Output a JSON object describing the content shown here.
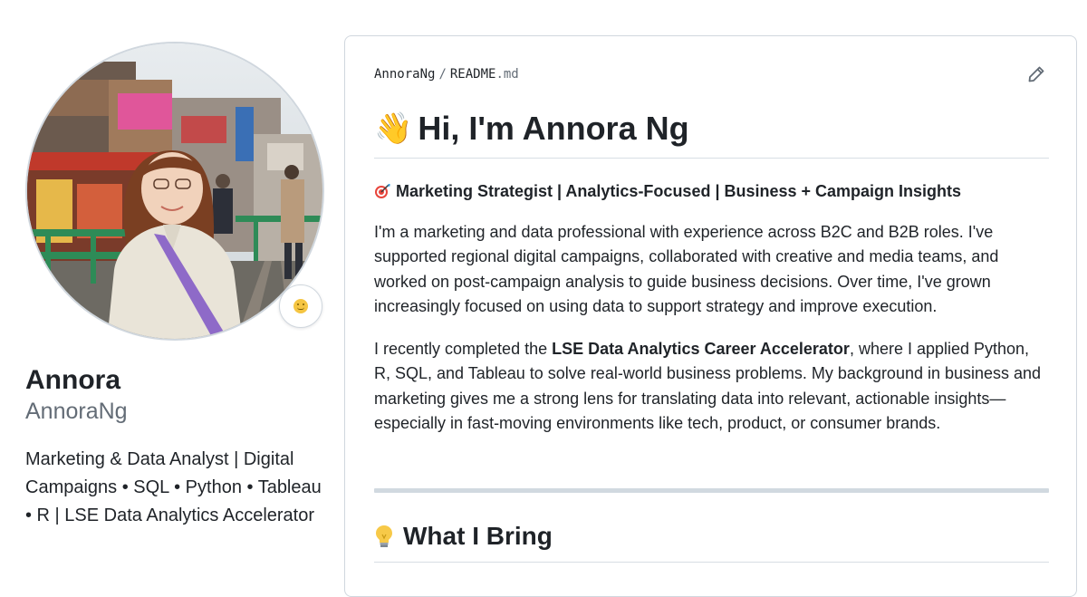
{
  "profile": {
    "name": "Annora",
    "login": "AnnoraNg",
    "bio": "Marketing & Data Analyst | Digital Campaigns • SQL • Python • Tableau • R | LSE Data Analytics Accelerator",
    "avatar_alt": "Profile photo",
    "status_icon": "smiley-emoji-icon"
  },
  "readme": {
    "crumb_owner": "AnnoraNg",
    "crumb_sep": "/",
    "crumb_file": "README",
    "crumb_ext": ".md",
    "edit_icon": "pencil-icon",
    "heading_emoji": "👋",
    "heading_text": "Hi, I'm Annora Ng",
    "tagline": "Marketing Strategist | Analytics-Focused | Business + Campaign Insights",
    "tagline_icon": "target-icon",
    "para1": "I'm a marketing and data professional with experience across B2C and B2B roles. I've supported regional digital campaigns, collaborated with creative and media teams, and worked on post-campaign analysis to guide business decisions. Over time, I've grown increasingly focused on using data to support strategy and improve execution.",
    "para2_before": "I recently completed the ",
    "para2_bold": "LSE Data Analytics Career Accelerator",
    "para2_after": ", where I applied Python, R, SQL, and Tableau to solve real-world business problems. My background in business and marketing gives me a strong lens for translating data into relevant, actionable insights—especially in fast-moving environments like tech, product, or consumer brands.",
    "section2_icon": "lightbulb-icon",
    "section2_heading": "What I Bring"
  },
  "colors": {
    "text": "#1f2328",
    "muted": "#636c76",
    "border": "#d0d7de",
    "divider": "#d8dee4"
  }
}
